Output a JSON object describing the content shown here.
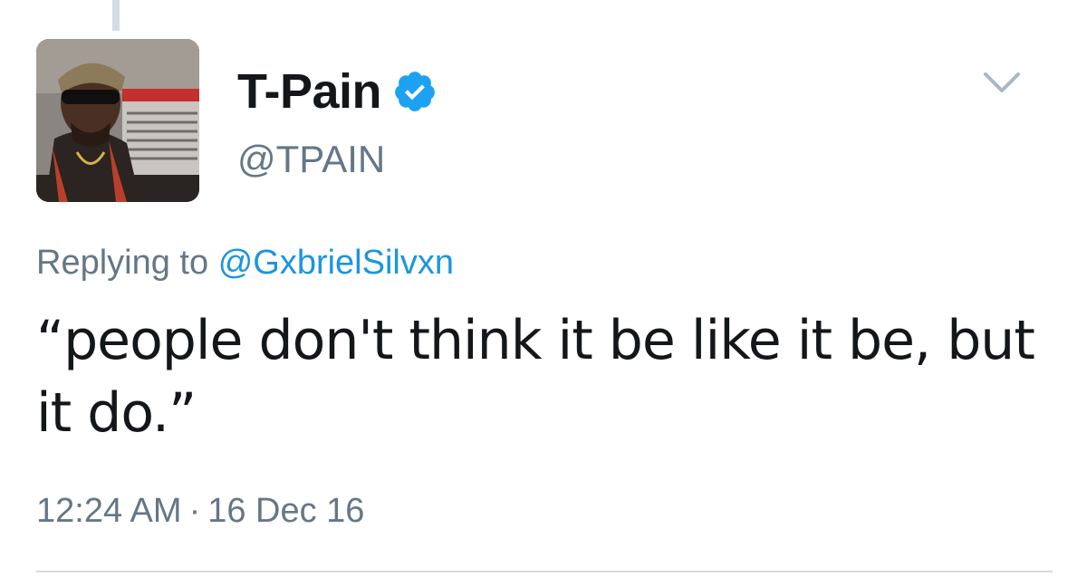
{
  "tweet": {
    "author": {
      "display_name": "T-Pain",
      "handle": "@TPAIN",
      "verified": true
    },
    "reply": {
      "prefix": "Replying to",
      "to_handle": "@GxbrielSilvxn"
    },
    "text": "“people don't think it be like it be, but it do.”",
    "time": "12:24 AM",
    "separator": "·",
    "date": "16 Dec 16"
  },
  "icons": {
    "verified": "verified-badge-icon",
    "more": "chevron-down-icon"
  },
  "colors": {
    "text_primary": "#14171a",
    "text_secondary": "#657786",
    "link": "#1b95e0",
    "verified_blue": "#1da1f2",
    "divider": "#d6dde3"
  }
}
